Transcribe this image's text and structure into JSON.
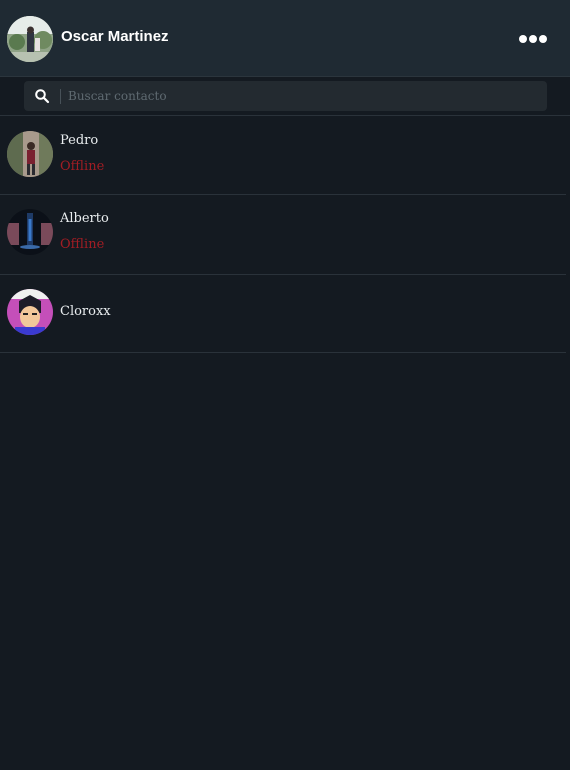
{
  "header": {
    "user_name": "Oscar Martinez",
    "menu_icon": "more-horizontal-icon"
  },
  "search": {
    "placeholder": "Buscar contacto",
    "value": "",
    "icon": "search-icon"
  },
  "contacts": [
    {
      "name": "Pedro",
      "status": "Offline"
    },
    {
      "name": "Alberto",
      "status": "Offline"
    },
    {
      "name": "Cloroxx",
      "status": ""
    }
  ],
  "colors": {
    "background": "#141a21",
    "header": "#1f2a33",
    "offline": "#a11d24"
  }
}
